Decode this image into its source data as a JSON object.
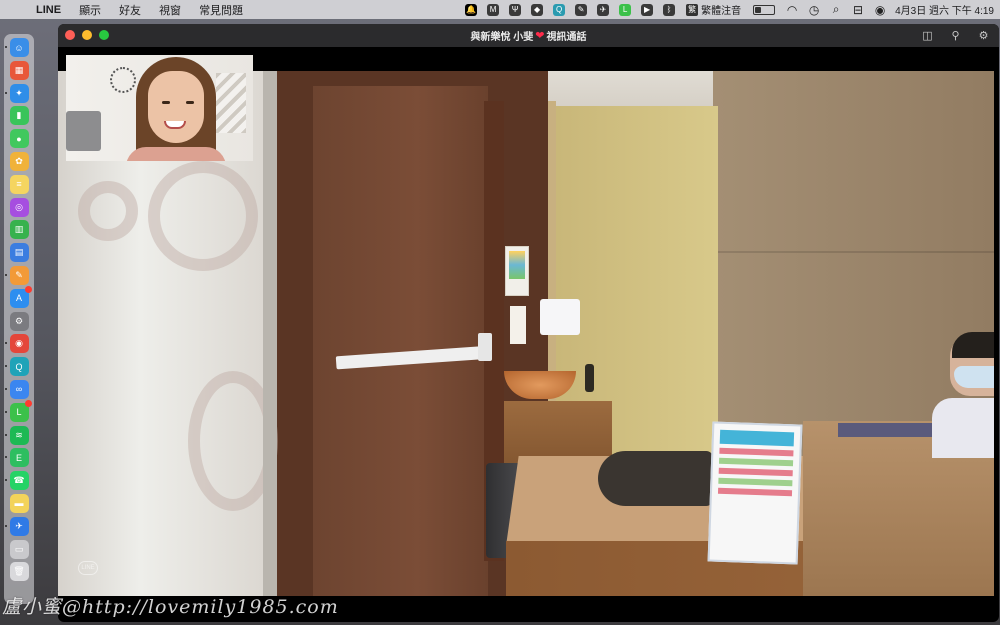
{
  "menubar": {
    "apple_glyph": "",
    "app_name": "LINE",
    "menus": [
      "顯示",
      "好友",
      "視窗",
      "常見問題"
    ],
    "status_icons": [
      {
        "name": "bell-icon",
        "glyph": "🔔",
        "color": "#000000"
      },
      {
        "name": "m-app-icon",
        "glyph": "M",
        "color": "#3a3a3a"
      },
      {
        "name": "tuning-fork-icon",
        "glyph": "Ψ",
        "color": "#3a3a3a"
      },
      {
        "name": "dropbox-icon",
        "glyph": "◆",
        "color": "#3a3a3a"
      },
      {
        "name": "search-app-icon",
        "glyph": "Q",
        "color": "#2a9bb0"
      },
      {
        "name": "evernote-icon",
        "glyph": "✎",
        "color": "#3a3a3a"
      },
      {
        "name": "bird-icon",
        "glyph": "✈",
        "color": "#3a3a3a"
      },
      {
        "name": "line-icon",
        "glyph": "L",
        "color": "#3cc14a"
      },
      {
        "name": "play-icon",
        "glyph": "▶",
        "color": "#3a3a3a"
      },
      {
        "name": "bluetooth-icon",
        "glyph": "ᛒ",
        "color": "#3a3a3a"
      }
    ],
    "input_method_glyph": "繁",
    "input_method": "繁體注音",
    "battery_level": 0.35,
    "right_icons": [
      {
        "name": "wifi-icon",
        "glyph": "◠"
      },
      {
        "name": "time-machine-icon",
        "glyph": "◷"
      },
      {
        "name": "spotlight-search-icon",
        "glyph": "⌕"
      },
      {
        "name": "control-center-icon",
        "glyph": "⊟"
      },
      {
        "name": "siri-icon",
        "glyph": "◉"
      }
    ],
    "datetime": "4月3日 週六 下午 4:19"
  },
  "dock": {
    "apps": [
      {
        "name": "finder-icon",
        "color": "#3a8ee8",
        "glyph": "☺",
        "running": true
      },
      {
        "name": "launchpad-icon",
        "color": "#e8573a",
        "glyph": "▦",
        "running": false
      },
      {
        "name": "safari-icon",
        "color": "#2f8ee8",
        "glyph": "✦",
        "running": true
      },
      {
        "name": "facetime-icon",
        "color": "#39c45a",
        "glyph": "▮",
        "running": false
      },
      {
        "name": "messages-icon",
        "color": "#40c85e",
        "glyph": "●",
        "running": false
      },
      {
        "name": "photos-icon",
        "color": "#f0b23a",
        "glyph": "✿",
        "running": false
      },
      {
        "name": "notes-icon",
        "color": "#f5d560",
        "glyph": "≡",
        "running": false
      },
      {
        "name": "podcasts-icon",
        "color": "#a64ee0",
        "glyph": "◎",
        "running": false
      },
      {
        "name": "numbers-icon",
        "color": "#37b24d",
        "glyph": "▥",
        "running": false
      },
      {
        "name": "keynote-icon",
        "color": "#3b7de0",
        "glyph": "▤",
        "running": false
      },
      {
        "name": "pages-icon",
        "color": "#f29a38",
        "glyph": "✎",
        "running": true
      },
      {
        "name": "app-store-icon",
        "color": "#2d8ef0",
        "glyph": "A",
        "running": false,
        "badge": true
      },
      {
        "name": "system-preferences-icon",
        "color": "#7b7b80",
        "glyph": "⚙",
        "running": false
      },
      {
        "name": "chrome-icon",
        "color": "#e4463a",
        "glyph": "◉",
        "running": true
      },
      {
        "name": "search-app-dock-icon",
        "color": "#1fa3b8",
        "glyph": "Q",
        "running": true
      },
      {
        "name": "baidu-netdisk-icon",
        "color": "#3b86f0",
        "glyph": "∞",
        "running": true
      },
      {
        "name": "line-dock-icon",
        "color": "#3cc14a",
        "glyph": "L",
        "running": true,
        "badge": true
      },
      {
        "name": "spotify-icon",
        "color": "#1db954",
        "glyph": "≋",
        "running": true
      },
      {
        "name": "evernote-dock-icon",
        "color": "#2dbe60",
        "glyph": "E",
        "running": true
      },
      {
        "name": "whatsapp-icon",
        "color": "#25d366",
        "glyph": "☎",
        "running": true
      },
      {
        "name": "stickies-icon",
        "color": "#f3d35a",
        "glyph": "▬",
        "running": false
      },
      {
        "name": "migration-bird-icon",
        "color": "#2f7ae6",
        "glyph": "✈",
        "running": true
      },
      {
        "name": "preview-icon",
        "color": "#c9c9cc",
        "glyph": "▭",
        "running": false
      },
      {
        "name": "trash-icon",
        "color": "#d9d9dc",
        "glyph": "🗑",
        "running": false
      }
    ]
  },
  "window": {
    "title_prefix": "與新樂悅 小斐",
    "title_heart": "❤",
    "title_suffix": "視訊通話",
    "traffic_lights": {
      "close": "#fe5f57",
      "minimize": "#febc2e",
      "zoom": "#28c840"
    },
    "toolbar": [
      {
        "name": "sidebar-toggle-icon",
        "glyph": "◫"
      },
      {
        "name": "pin-icon",
        "glyph": "⚲"
      },
      {
        "name": "settings-gear-icon",
        "glyph": "⚙"
      }
    ],
    "video_watermark": "LINE"
  },
  "blog_watermark": "盧小蜜@http://lovemily1985.com"
}
